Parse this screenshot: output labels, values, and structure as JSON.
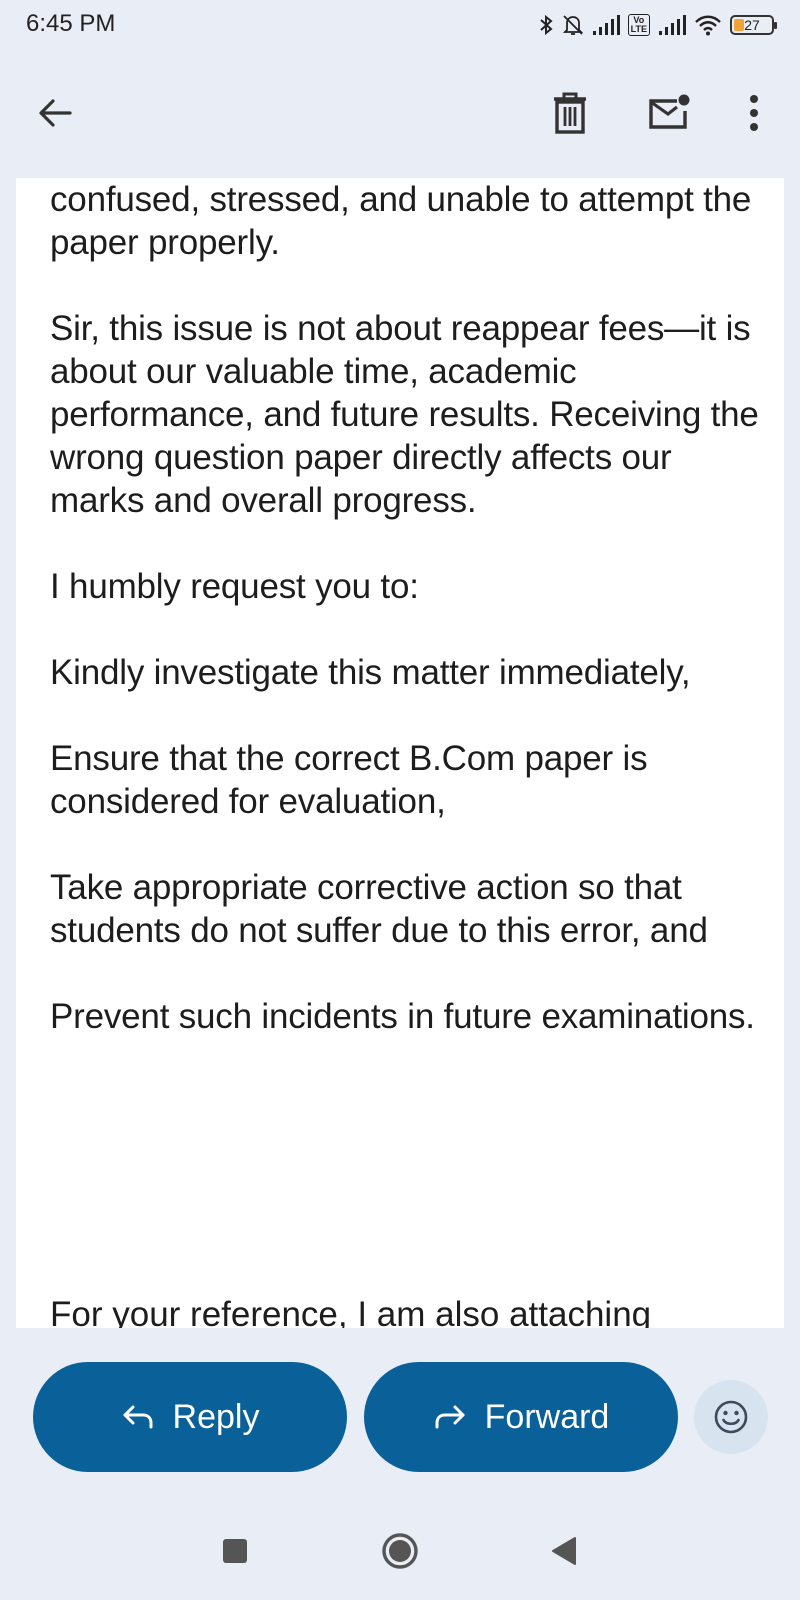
{
  "status_bar": {
    "time": "6:45 PM",
    "volte": "Vo\nLTE",
    "battery": "27",
    "battery_level": 0.27,
    "icons": [
      "bluetooth-icon",
      "bell-off-icon",
      "signal-icon",
      "volte-icon",
      "signal-icon",
      "wifi-icon",
      "battery-icon"
    ]
  },
  "toolbar": {
    "icons": [
      "back-arrow-icon",
      "trash-icon",
      "mark-unread-icon",
      "more-vert-icon"
    ]
  },
  "message": {
    "paragraphs": [
      "confused, stressed, and unable to attempt the paper properly.",
      "Sir, this issue is not about reappear fees—it is about our valuable time, academic performance, and future results. Receiving the wrong question paper directly affects our marks and overall progress.",
      "I humbly request you to:",
      "Kindly investigate this matter immediately,",
      "Ensure that the correct B.Com paper is considered for evaluation,",
      "Take appropriate corrective action so that students do not suffer due to this error, and",
      "Prevent such incidents in future examinations."
    ],
    "cut_off_line": "For your reference, I am also attaching"
  },
  "actions": {
    "reply_label": "Reply",
    "forward_label": "Forward",
    "reply_icon": "reply-arrow-icon",
    "forward_icon": "forward-arrow-icon",
    "emoji_icon": "emoji-icon"
  },
  "colors": {
    "accent": "#0a6199",
    "background": "#e9edf6",
    "emoji_bg": "#d8e3f0",
    "battery": "#f1a33a"
  }
}
